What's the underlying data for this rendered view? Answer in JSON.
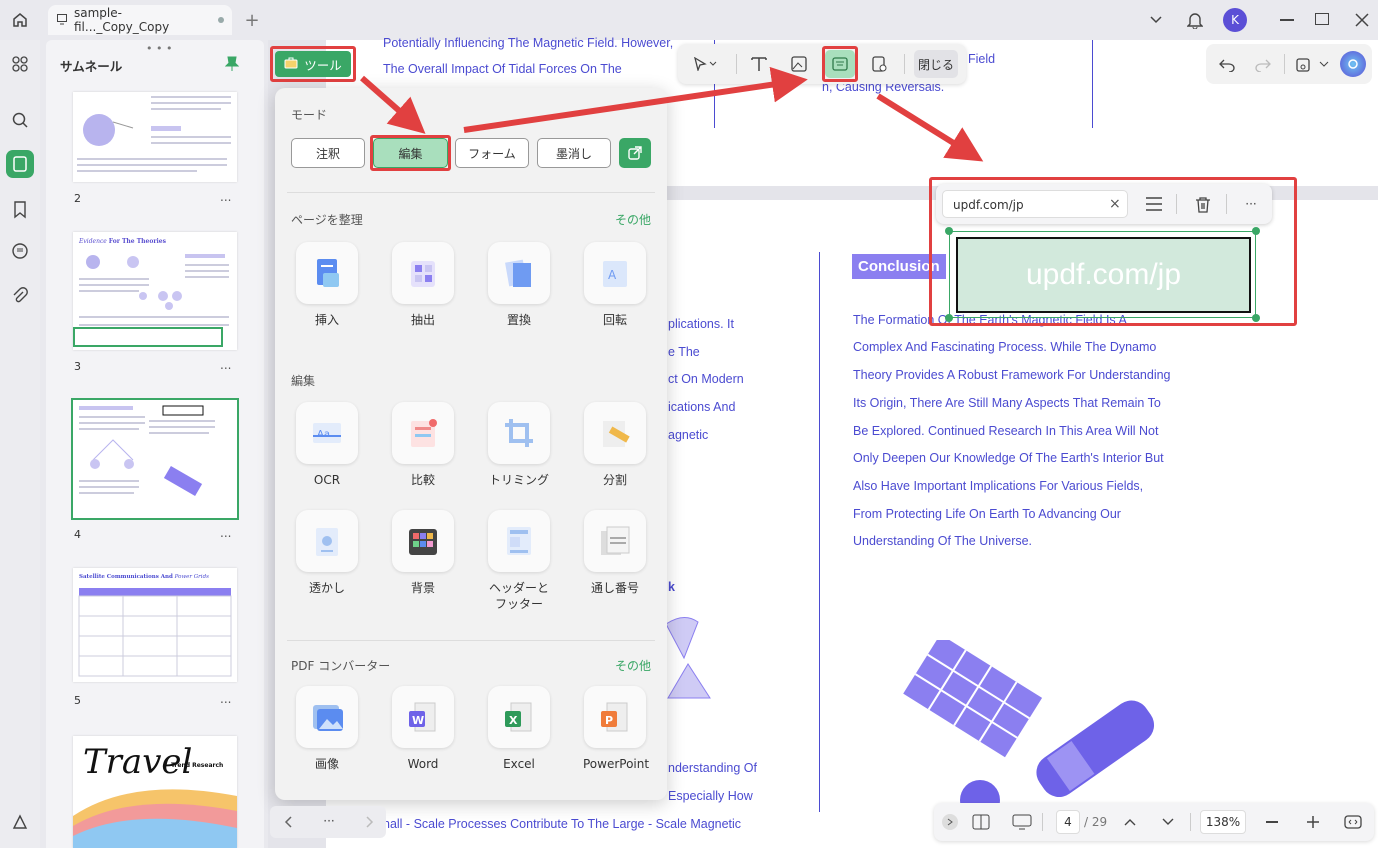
{
  "titlebar": {
    "tab_title": "sample-fil..._Copy_Copy",
    "new_tab": "+",
    "avatar_letter": "K"
  },
  "thumbs": {
    "title": "サムネール",
    "pages": [
      "2",
      "3",
      "4",
      "5"
    ],
    "more": "...",
    "thumb3_title_italic": "Evidence",
    "thumb3_title": "For The Theories",
    "thumb5_title": "Satellite Communications And",
    "thumb5_title_italic": "Power Grids",
    "thumb6_title": "Travel",
    "thumb6_sub": "Trend Research"
  },
  "tools_button": {
    "label": "ツール"
  },
  "tools_panel": {
    "mode_title": "モード",
    "modes": [
      "注釈",
      "編集",
      "フォーム",
      "墨消し"
    ],
    "organize": {
      "title": "ページを整理",
      "more": "その他",
      "items": [
        "挿入",
        "抽出",
        "置換",
        "回転"
      ]
    },
    "edit": {
      "title": "編集",
      "items": [
        "OCR",
        "比較",
        "トリミング",
        "分割",
        "透かし",
        "背景",
        "ヘッダーと\nフッター",
        "通し番号"
      ]
    },
    "convert": {
      "title": "PDF コンバーター",
      "more": "その他",
      "items": [
        "画像",
        "Word",
        "Excel",
        "PowerPoint"
      ]
    }
  },
  "edit_toolbar": {
    "close": "閉じる"
  },
  "watermark_popup": {
    "text": "updf.com/jp",
    "clear": "×",
    "more": "···"
  },
  "watermark_box": {
    "text": "updf.com/jp"
  },
  "doc_top": {
    "lines": [
      "Potentially Influencing The Magnetic Field. However,",
      "The Overall Impact Of Tidal Forces On The"
    ],
    "right_lines": [
      "Field",
      "n, Causing Reversals."
    ]
  },
  "doc_middle": {
    "lines": [
      "plications. It",
      "e The",
      "ct On Modern",
      "ications And",
      "agnetic"
    ],
    "bottom_lines": [
      "nderstanding Of",
      "Especially How",
      "nall - Scale Processes Contribute To The Large - Scale Magnetic"
    ],
    "k": "k"
  },
  "conclusion": {
    "heading": "Conclusion",
    "lines": [
      "The Formation Of The Earth's Magnetic Field Is A",
      "Complex And Fascinating Process. While The Dynamo",
      "Theory Provides A Robust Framework For Understanding",
      "Its Origin, There Are Still Many Aspects That Remain To",
      "Be Explored. Continued Research In This Area Will Not",
      "Only Deepen Our Knowledge Of The Earth's Interior But",
      "Also Have Important Implications For Various Fields,",
      "From Protecting Life On Earth To Advancing Our",
      "Understanding Of The Universe."
    ]
  },
  "bottom_nav": {
    "more": "···"
  },
  "bottom_bar": {
    "page_current": "4",
    "page_total": "/ 29",
    "zoom": "138%"
  },
  "colors": {
    "accent": "#3aa766",
    "highlight": "#e14040",
    "doc_text": "#4b4bd1"
  }
}
